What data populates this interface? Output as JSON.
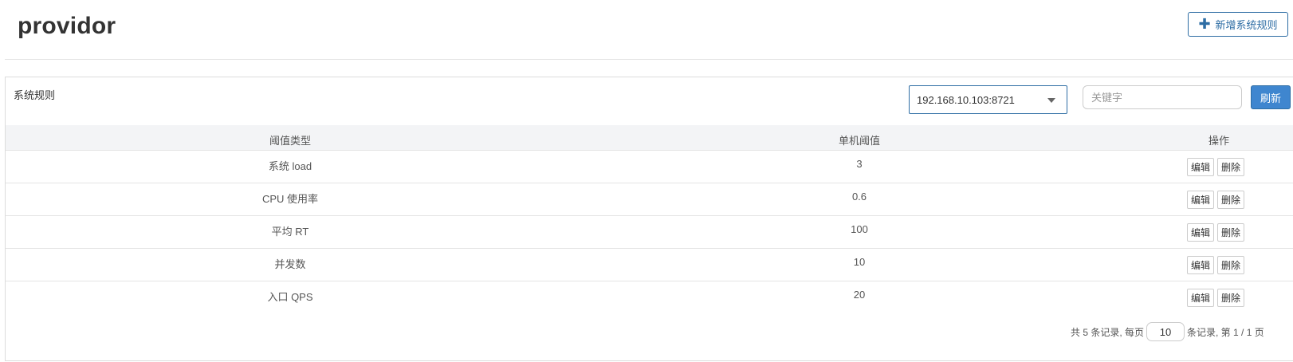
{
  "header": {
    "title": "providor",
    "add_button_label": "新增系统规则",
    "add_button_icon": "plus-icon"
  },
  "panel": {
    "title": "系统规则",
    "machine_select": {
      "selected": "192.168.10.103:8721"
    },
    "search": {
      "value": "",
      "placeholder": "关键字"
    },
    "refresh_label": "刷新"
  },
  "table": {
    "columns": [
      "阈值类型",
      "单机阈值",
      "操作"
    ],
    "rows": [
      {
        "type": "系统 load",
        "threshold": "3"
      },
      {
        "type": "CPU 使用率",
        "threshold": "0.6"
      },
      {
        "type": "平均 RT",
        "threshold": "100"
      },
      {
        "type": "并发数",
        "threshold": "10"
      },
      {
        "type": "入口 QPS",
        "threshold": "20"
      }
    ],
    "edit_label": "编辑",
    "delete_label": "删除"
  },
  "pagination": {
    "prefix": "共 5 条记录, 每页",
    "page_size": "10",
    "suffix": "条记录, 第 1 / 1 页"
  },
  "colors": {
    "primary": "#3f86cf",
    "primary_border": "#2e6da4",
    "header_bg": "#f3f4f6"
  }
}
